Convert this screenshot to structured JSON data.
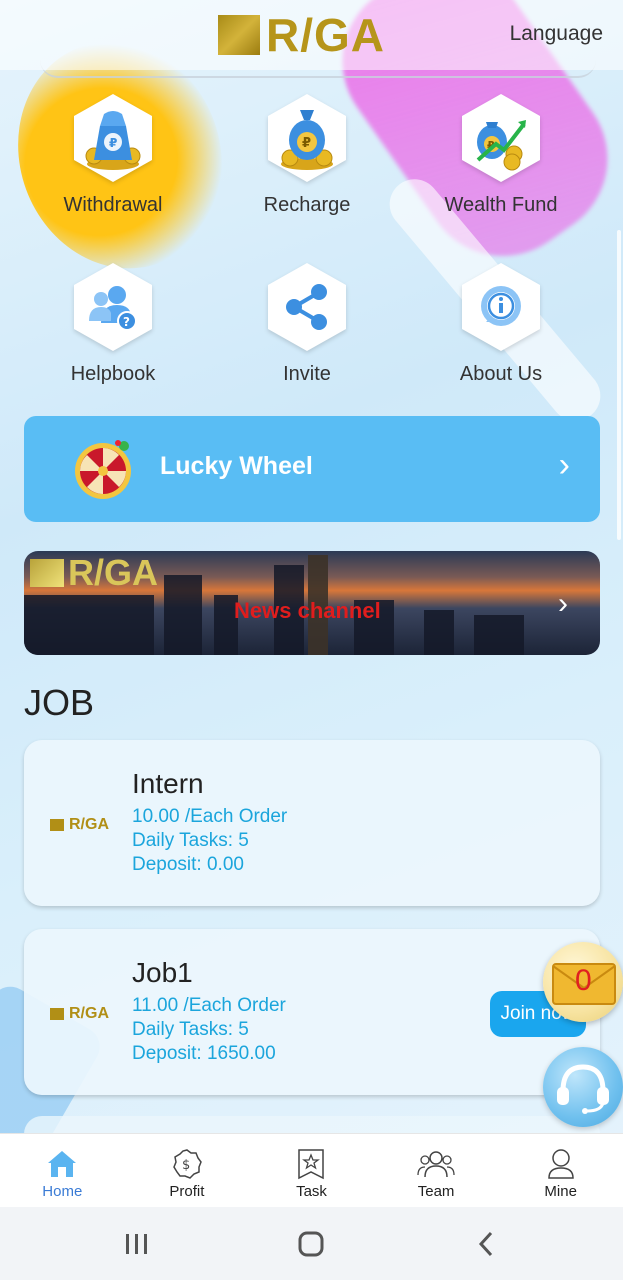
{
  "header": {
    "logo_text": "R/GA",
    "language_label": "Language"
  },
  "grid": [
    {
      "label": "Withdrawal",
      "icon": "money-bag-icon"
    },
    {
      "label": "Recharge",
      "icon": "coin-bag-icon"
    },
    {
      "label": "Wealth Fund",
      "icon": "growth-fund-icon"
    },
    {
      "label": "Helpbook",
      "icon": "users-help-icon"
    },
    {
      "label": "Invite",
      "icon": "share-icon"
    },
    {
      "label": "About Us",
      "icon": "info-icon"
    }
  ],
  "lucky_wheel": {
    "label": "Lucky Wheel"
  },
  "news": {
    "logo_text": "R/GA",
    "label": "News channel"
  },
  "job_section": {
    "title": "JOB"
  },
  "jobs": [
    {
      "logo": "R/GA",
      "name": "Intern",
      "rate": "10.00 /Each Order",
      "tasks": "Daily Tasks: 5",
      "deposit": "Deposit: 0.00"
    },
    {
      "logo": "R/GA",
      "name": "Job1",
      "rate": "11.00 /Each Order",
      "tasks": "Daily Tasks: 5",
      "deposit": "Deposit: 1650.00",
      "button": "Join now"
    }
  ],
  "mail": {
    "count": "0"
  },
  "bottom_nav": [
    {
      "label": "Home",
      "active": true
    },
    {
      "label": "Profit"
    },
    {
      "label": "Task"
    },
    {
      "label": "Team"
    },
    {
      "label": "Mine"
    }
  ],
  "colors": {
    "accent": "#59bdf4",
    "gold": "#b6951a",
    "job_text": "#1ba5dc",
    "active_nav": "#3a7bd5"
  }
}
